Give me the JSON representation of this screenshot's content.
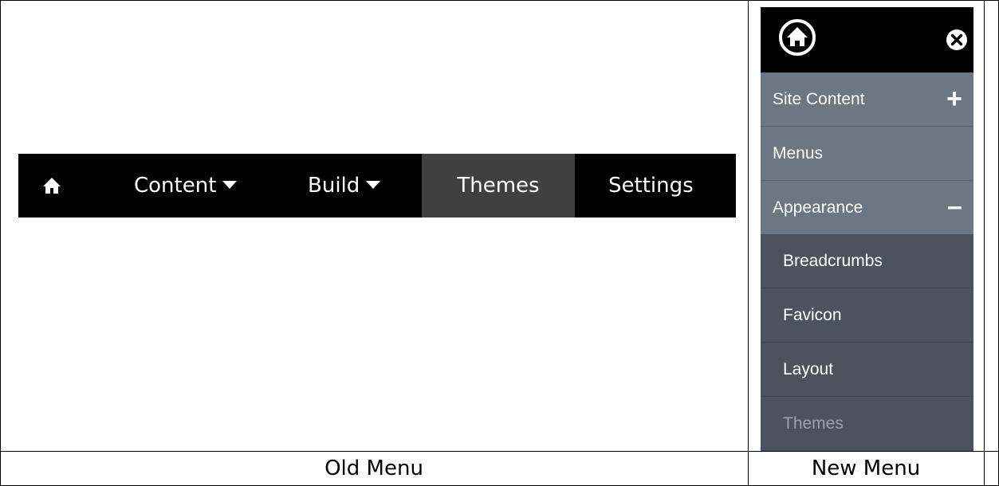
{
  "old_menu": {
    "caption": "Old Menu",
    "items": [
      {
        "label": "",
        "icon": "home-icon"
      },
      {
        "label": "Content",
        "has_dropdown": true
      },
      {
        "label": "Build",
        "has_dropdown": true
      },
      {
        "label": "Themes",
        "active": true
      },
      {
        "label": "Settings"
      }
    ]
  },
  "new_menu": {
    "caption": "New Menu",
    "header": {
      "home_icon": "home-circle-icon",
      "close_icon": "close-circle-icon"
    },
    "items": [
      {
        "label": "Site Content",
        "sign": "+"
      },
      {
        "label": "Menus"
      },
      {
        "label": "Appearance",
        "sign": "–"
      }
    ],
    "sub_items": [
      {
        "label": "Breadcrumbs"
      },
      {
        "label": "Favicon"
      },
      {
        "label": "Layout"
      },
      {
        "label": "Themes",
        "dimmed": true
      }
    ]
  },
  "colors": {
    "old_bar": "#000000",
    "old_active": "#404040",
    "new_header": "#000000",
    "new_top_item": "#6b7782",
    "new_sub_item": "#4b535c",
    "dim_text": "#9aa2aa"
  }
}
